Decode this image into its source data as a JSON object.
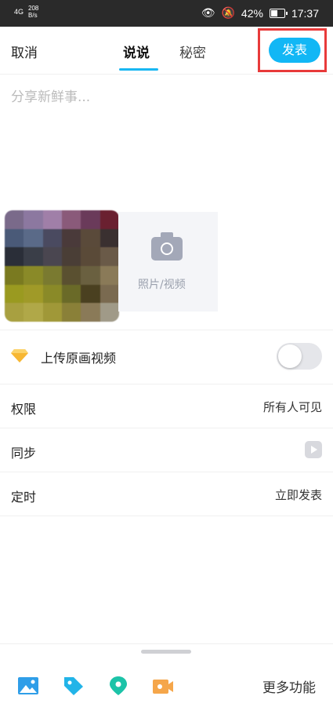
{
  "status_bar": {
    "signal": "4G",
    "speed": "208",
    "speed_unit": "B/s",
    "battery": "42%",
    "time": "17:37"
  },
  "nav": {
    "cancel_label": "取消",
    "tabs": [
      {
        "label": "说说",
        "active": true
      },
      {
        "label": "秘密",
        "active": false
      }
    ],
    "publish_label": "发表"
  },
  "editor": {
    "placeholder": "分享新鲜事..."
  },
  "media": {
    "add_label": "照片/视频"
  },
  "settings": {
    "upload_original": {
      "label": "上传原画视频",
      "enabled": false
    },
    "permission": {
      "label": "权限",
      "value": "所有人可见"
    },
    "sync": {
      "label": "同步"
    },
    "schedule": {
      "label": "定时",
      "value": "立即发表"
    }
  },
  "bottom_bar": {
    "more_label": "更多功能"
  },
  "colors": {
    "accent": "#12b7f5",
    "highlight_frame": "#e83a3a"
  }
}
